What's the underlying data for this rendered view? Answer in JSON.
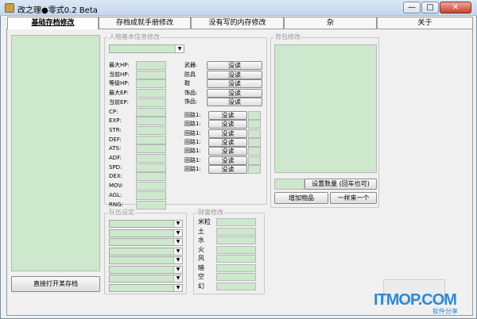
{
  "window": {
    "title": "改之理●零式0.2 Beta",
    "min": "—",
    "max": "□",
    "close": "✕"
  },
  "tabs": [
    {
      "label": "基础存档修改"
    },
    {
      "label": "存档成就手册修改"
    },
    {
      "label": "没有写的内存修改"
    },
    {
      "label": "杂"
    },
    {
      "label": "关于"
    }
  ],
  "left": {
    "open_button": "直接打开某存档"
  },
  "character": {
    "group_label": "人物基本信息修改",
    "stats": [
      "最大HP:",
      "当前HP:",
      "等级HP:",
      "最大EP:",
      "当前EP:",
      "CP:",
      "EXP:",
      "STR:",
      "DEF:",
      "ATS:",
      "ADF:",
      "SPD:",
      "DEX:",
      "MOV:",
      "AGL:",
      "RNG:"
    ],
    "equip_labels": [
      "武器:",
      "防具",
      "鞋",
      "饰品:",
      "饰品:"
    ],
    "read_label": "没读",
    "circuit_label": "回路1:"
  },
  "team": {
    "group_label": "队伍设定"
  },
  "wealth": {
    "group_label": "财富修改",
    "items": [
      "米粒",
      "土",
      "水",
      "火",
      "风",
      "暗",
      "空",
      "幻"
    ]
  },
  "bag": {
    "group_label": "背包修改",
    "set_count_button": "设置数量 (回车也可)",
    "add_item_button": "增加物品",
    "one_more_button": "一样来一个"
  },
  "watermark": {
    "text": "ITMOP.COM",
    "sub": "软件分享"
  }
}
